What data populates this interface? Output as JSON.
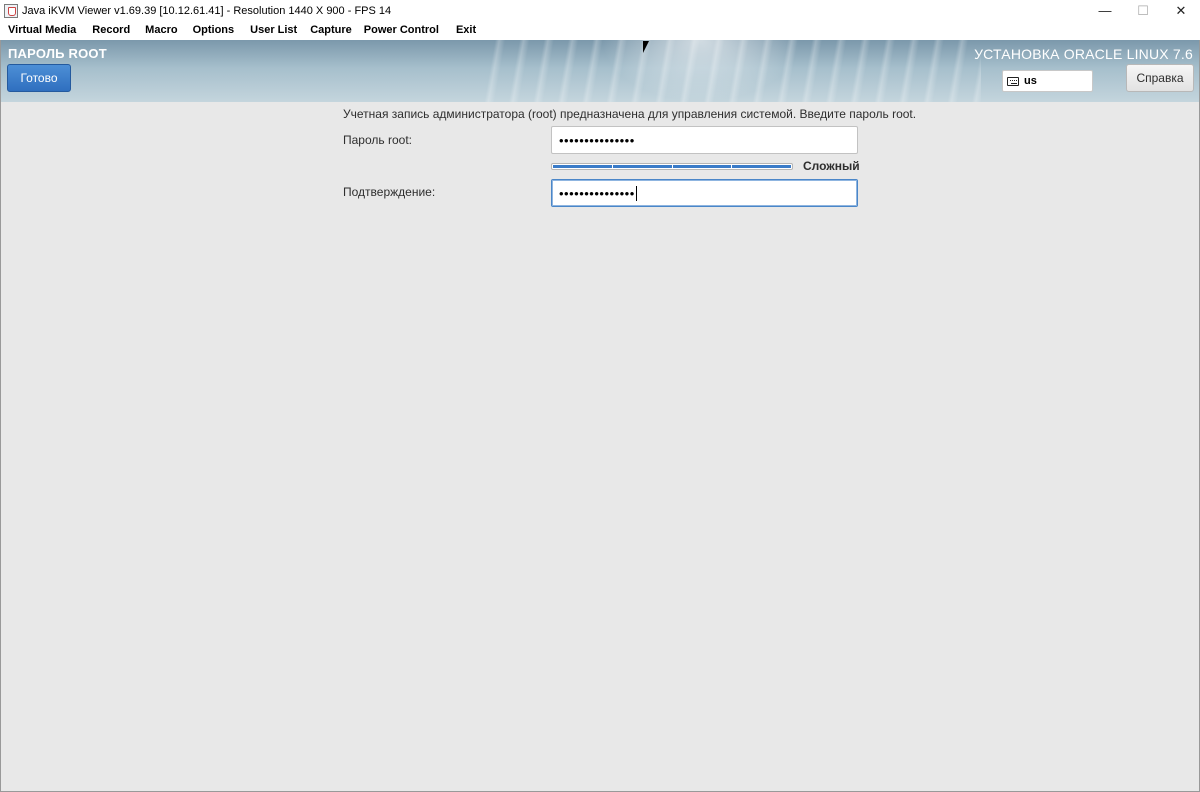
{
  "window": {
    "title": "Java iKVM Viewer v1.69.39 [10.12.61.41]  - Resolution 1440 X 900 - FPS 14",
    "minimize": "—",
    "maximize": "☐",
    "close": "✕"
  },
  "menubar": {
    "items": [
      "Virtual Media",
      "Record",
      "Macro",
      "Options",
      "User List",
      "Capture",
      "Power Control",
      "Exit"
    ]
  },
  "installer": {
    "spoke_title": "ПАРОЛЬ ROOT",
    "done_label": "Готово",
    "product_title": "УСТАНОВКА ORACLE LINUX 7.6",
    "keyboard_layout": "us",
    "help_label": "Справка",
    "intro": "Учетная запись администратора (root) предназначена для управления системой. Введите пароль root.",
    "password_label": "Пароль root:",
    "password_value": "•••••••••••••••",
    "strength_label": "Сложный",
    "strength_level": 1.0,
    "confirm_label": "Подтверждение:",
    "confirm_value": "•••••••••••••••",
    "accent_color": "#3a7bc8"
  }
}
